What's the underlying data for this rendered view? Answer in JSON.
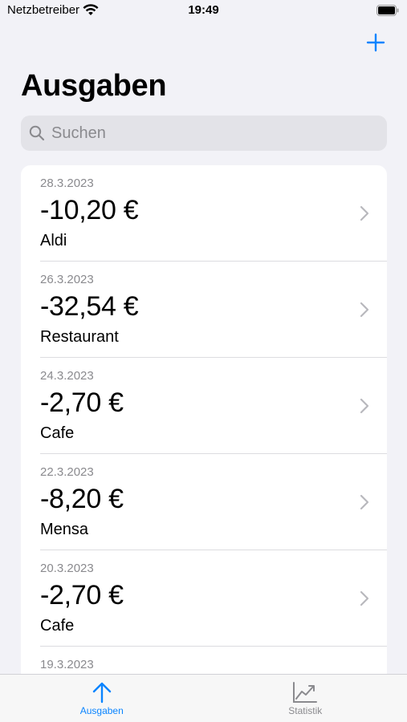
{
  "status_bar": {
    "carrier": "Netzbetreiber",
    "time": "19:49"
  },
  "nav": {
    "title": "Ausgaben"
  },
  "search": {
    "placeholder": "Suchen"
  },
  "expenses": [
    {
      "date": "28.3.2023",
      "amount": "-10,20 €",
      "description": "Aldi"
    },
    {
      "date": "26.3.2023",
      "amount": "-32,54 €",
      "description": "Restaurant"
    },
    {
      "date": "24.3.2023",
      "amount": "-2,70 €",
      "description": "Cafe"
    },
    {
      "date": "22.3.2023",
      "amount": "-8,20 €",
      "description": "Mensa"
    },
    {
      "date": "20.3.2023",
      "amount": "-2,70 €",
      "description": "Cafe"
    },
    {
      "date": "19.3.2023",
      "amount": "",
      "description": ""
    }
  ],
  "tabs": [
    {
      "label": "Ausgaben",
      "icon": "arrow-up-icon",
      "active": true
    },
    {
      "label": "Statistik",
      "icon": "chart-icon",
      "active": false
    }
  ],
  "colors": {
    "accent": "#0a84ff",
    "background": "#f2f2f7",
    "inactive": "#8a8a8e"
  }
}
